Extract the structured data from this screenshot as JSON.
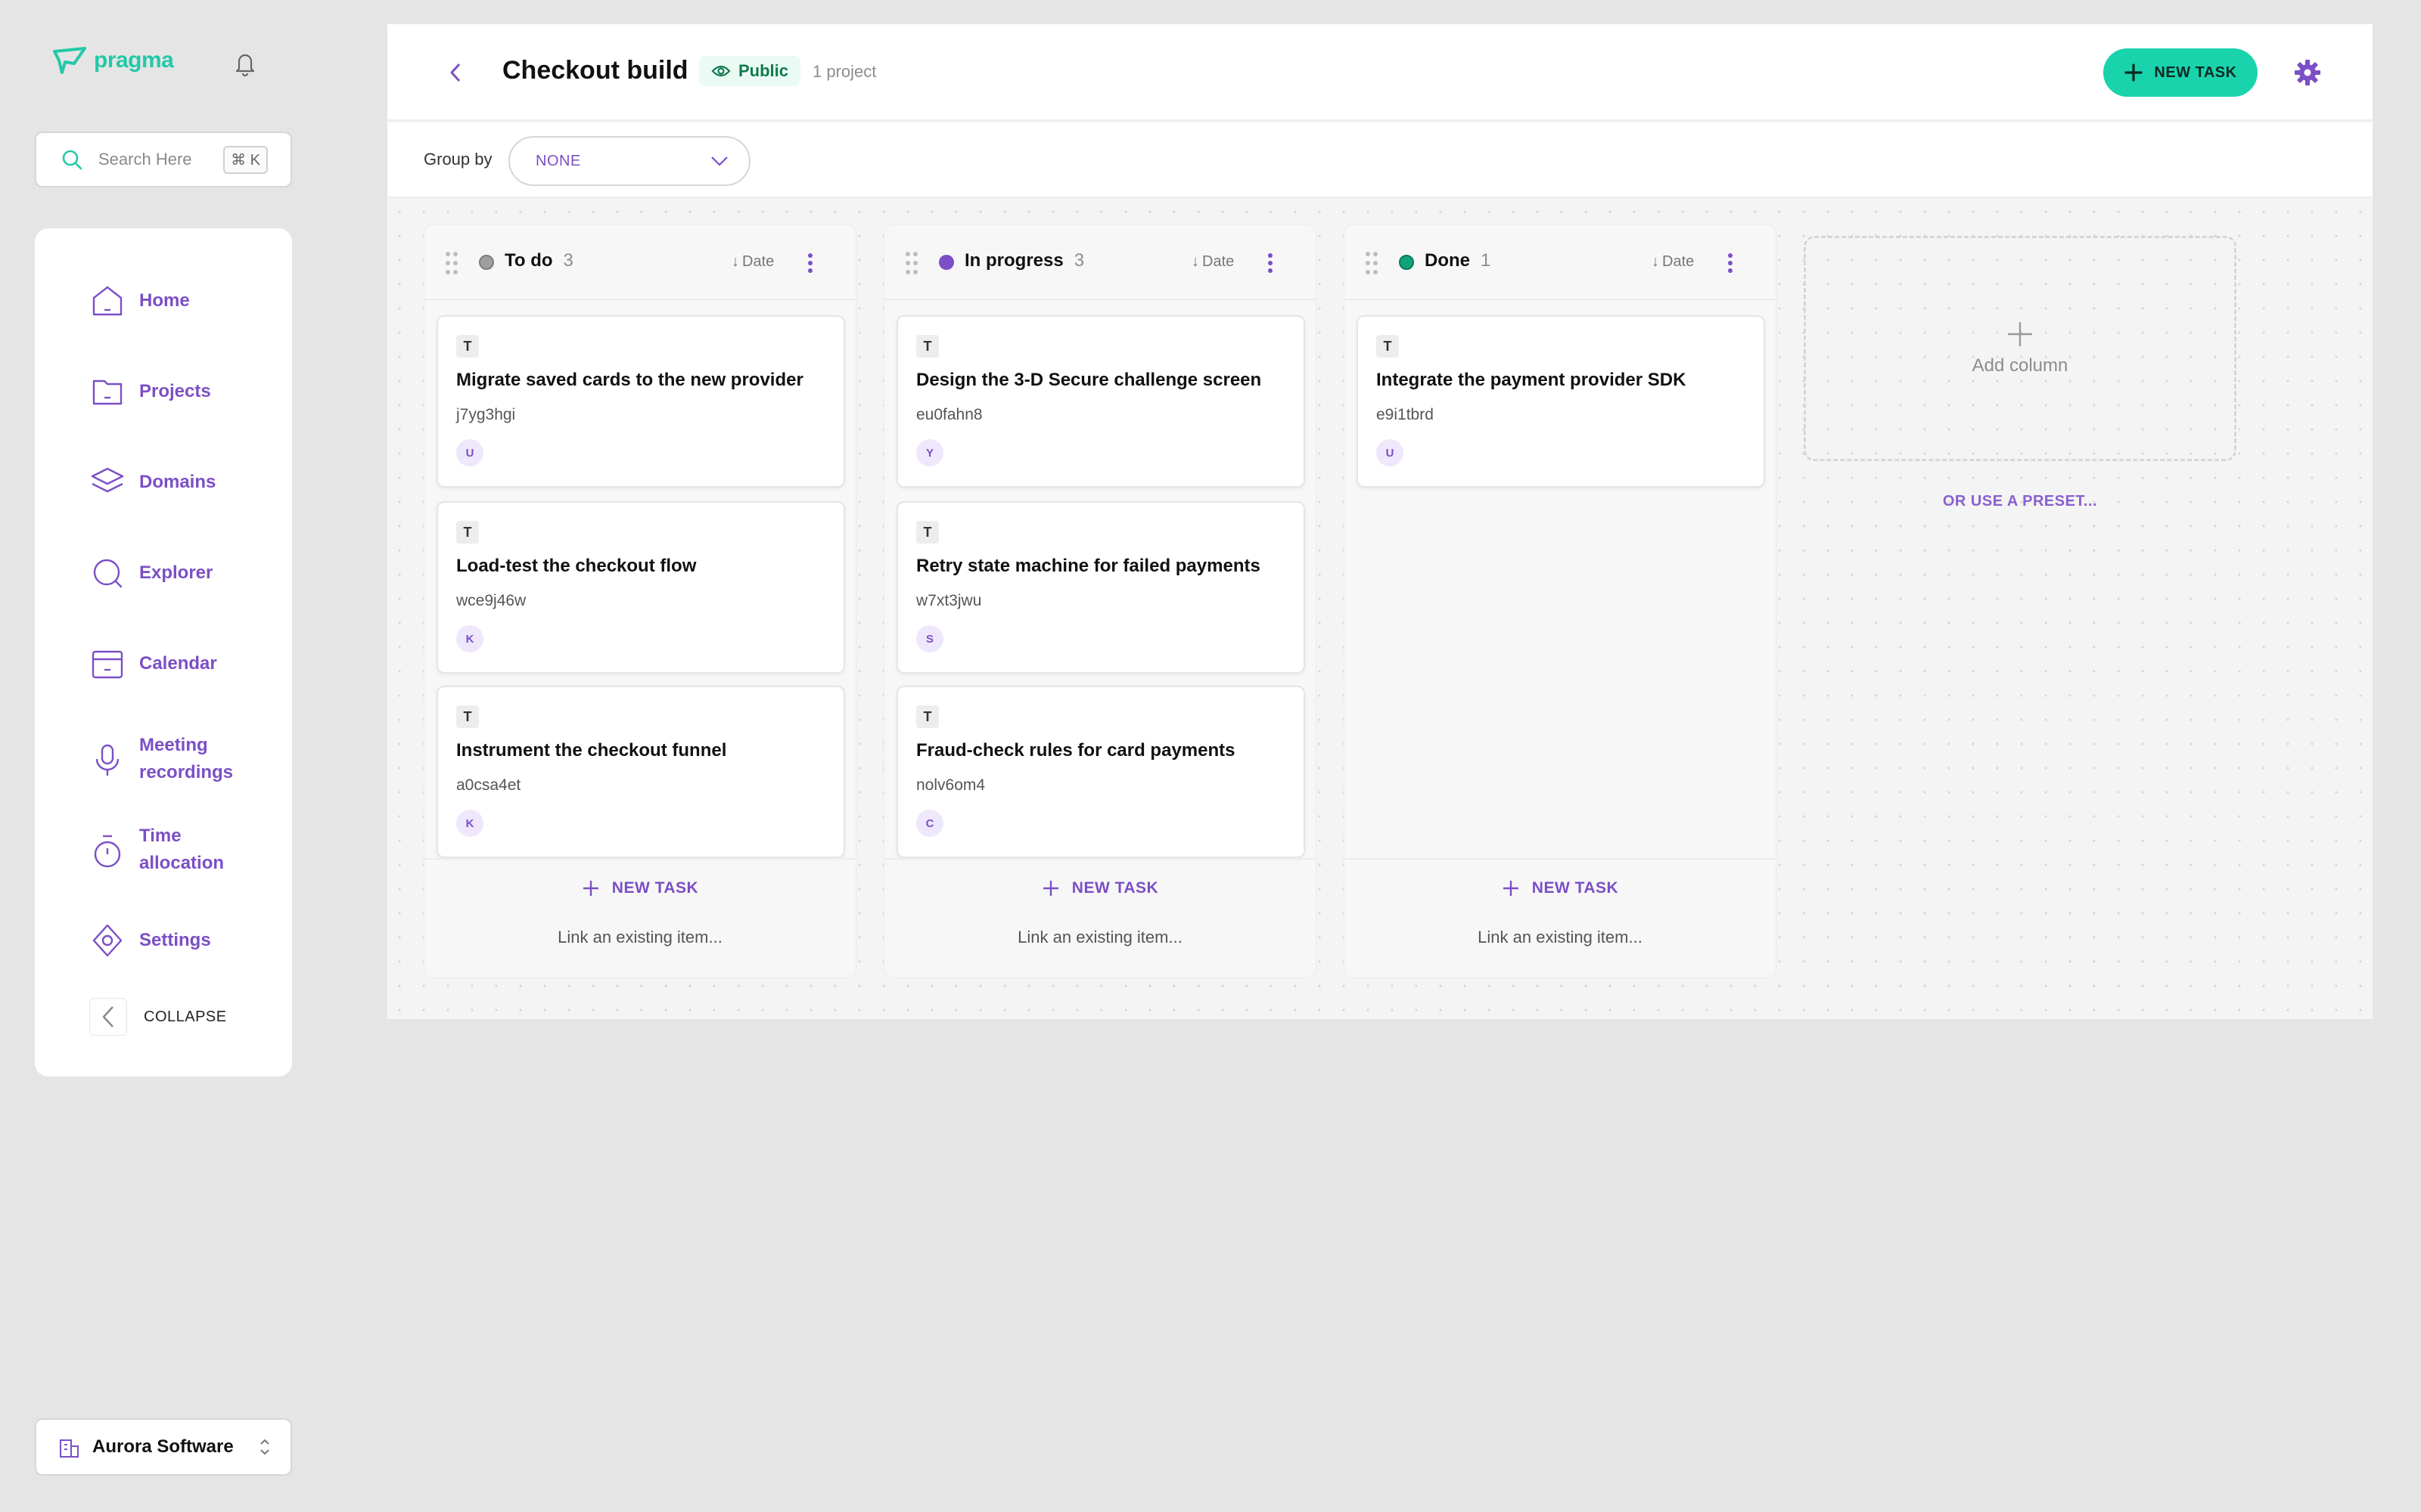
{
  "app": {
    "logo": "pragma"
  },
  "colors": {
    "accent": "#19d3ad",
    "brand_purple": "#7b4fc6",
    "todo_dot": "#9e9e9e",
    "in_progress_dot": "#7b4fc6",
    "done_dot": "#11a37a"
  },
  "search": {
    "placeholder": "Search Here",
    "shortcut": "⌘ K"
  },
  "sidebar": {
    "items": [
      {
        "label": "Home",
        "icon": "home-icon"
      },
      {
        "label": "Projects",
        "icon": "folder-icon"
      },
      {
        "label": "Domains",
        "icon": "layers-icon"
      },
      {
        "label": "Explorer",
        "icon": "search-circle-icon"
      },
      {
        "label": "Calendar",
        "icon": "calendar-icon"
      },
      {
        "label": "Meeting recordings",
        "icon": "microphone-icon"
      },
      {
        "label": "Time allocation",
        "icon": "stopwatch-icon"
      },
      {
        "label": "Settings",
        "icon": "settings-icon"
      }
    ],
    "collapse_label": "COLLAPSE"
  },
  "org": {
    "name": "Aurora Software"
  },
  "header": {
    "title": "Checkout build",
    "visibility": "Public",
    "project_count": "1 project",
    "new_task_label": "NEW TASK"
  },
  "groupby": {
    "label": "Group by",
    "value": "NONE"
  },
  "columns": [
    {
      "title": "To do",
      "count": "3",
      "sort": "Date",
      "cards": [
        {
          "type": "T",
          "title": "Migrate saved cards to the new provider",
          "id": "j7yg3hgi",
          "avatar": "U"
        },
        {
          "type": "T",
          "title": "Load-test the checkout flow",
          "id": "wce9j46w",
          "avatar": "K"
        },
        {
          "type": "T",
          "title": "Instrument the checkout funnel",
          "id": "a0csa4et",
          "avatar": "K"
        }
      ],
      "new_task_label": "NEW TASK",
      "link_label": "Link an existing item..."
    },
    {
      "title": "In progress",
      "count": "3",
      "sort": "Date",
      "cards": [
        {
          "type": "T",
          "title": "Design the 3-D Secure challenge screen",
          "id": "eu0fahn8",
          "avatar": "Y"
        },
        {
          "type": "T",
          "title": "Retry state machine for failed payments",
          "id": "w7xt3jwu",
          "avatar": "S"
        },
        {
          "type": "T",
          "title": "Fraud-check rules for card payments",
          "id": "nolv6om4",
          "avatar": "C"
        }
      ],
      "new_task_label": "NEW TASK",
      "link_label": "Link an existing item..."
    },
    {
      "title": "Done",
      "count": "1",
      "sort": "Date",
      "cards": [
        {
          "type": "T",
          "title": "Integrate the payment provider SDK",
          "id": "e9i1tbrd",
          "avatar": "U"
        }
      ],
      "new_task_label": "NEW TASK",
      "link_label": "Link an existing item..."
    }
  ],
  "add_column": {
    "label": "Add column",
    "preset_label": "OR USE A PRESET..."
  }
}
